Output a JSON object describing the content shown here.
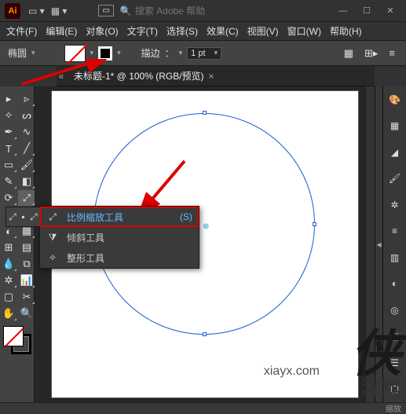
{
  "titlebar": {
    "logo": "Ai",
    "search_placeholder": "搜索 Adobe 帮助"
  },
  "menu": {
    "file": "文件(F)",
    "edit": "编辑(E)",
    "object": "对象(O)",
    "type": "文字(T)",
    "select": "选择(S)",
    "effect": "效果(C)",
    "view": "视图(V)",
    "window": "窗口(W)",
    "help": "帮助(H)"
  },
  "options": {
    "tool_label": "椭圆",
    "stroke_label": "描边",
    "stroke_value": "1 pt"
  },
  "document": {
    "tab_title": "未标题-1* @ 100% (RGB/预览)"
  },
  "flyout": {
    "items": [
      {
        "icon": "⤢",
        "label": "比例缩放工具",
        "shortcut": "(S)",
        "highlighted": true
      },
      {
        "icon": "�主",
        "label": "倾斜工具",
        "shortcut": "",
        "highlighted": false
      },
      {
        "icon": "✦",
        "label": "整形工具",
        "shortcut": "",
        "highlighted": false
      }
    ]
  },
  "right_panel": {
    "icons": [
      "palette",
      "libs",
      "colorguide",
      "swatches",
      "brush",
      "symbol",
      "stroke2",
      "grad",
      "trans",
      "appearance",
      "graphic",
      "layers",
      "artbd"
    ]
  },
  "watermark": {
    "char": "侠",
    "text": "游戏",
    "url": "xiayx.com"
  },
  "status": {
    "text": "缩放"
  },
  "colors": {
    "accent": "#1a5fd0",
    "highlight_link": "#6bb7ff",
    "anno_red": "#d00000"
  }
}
